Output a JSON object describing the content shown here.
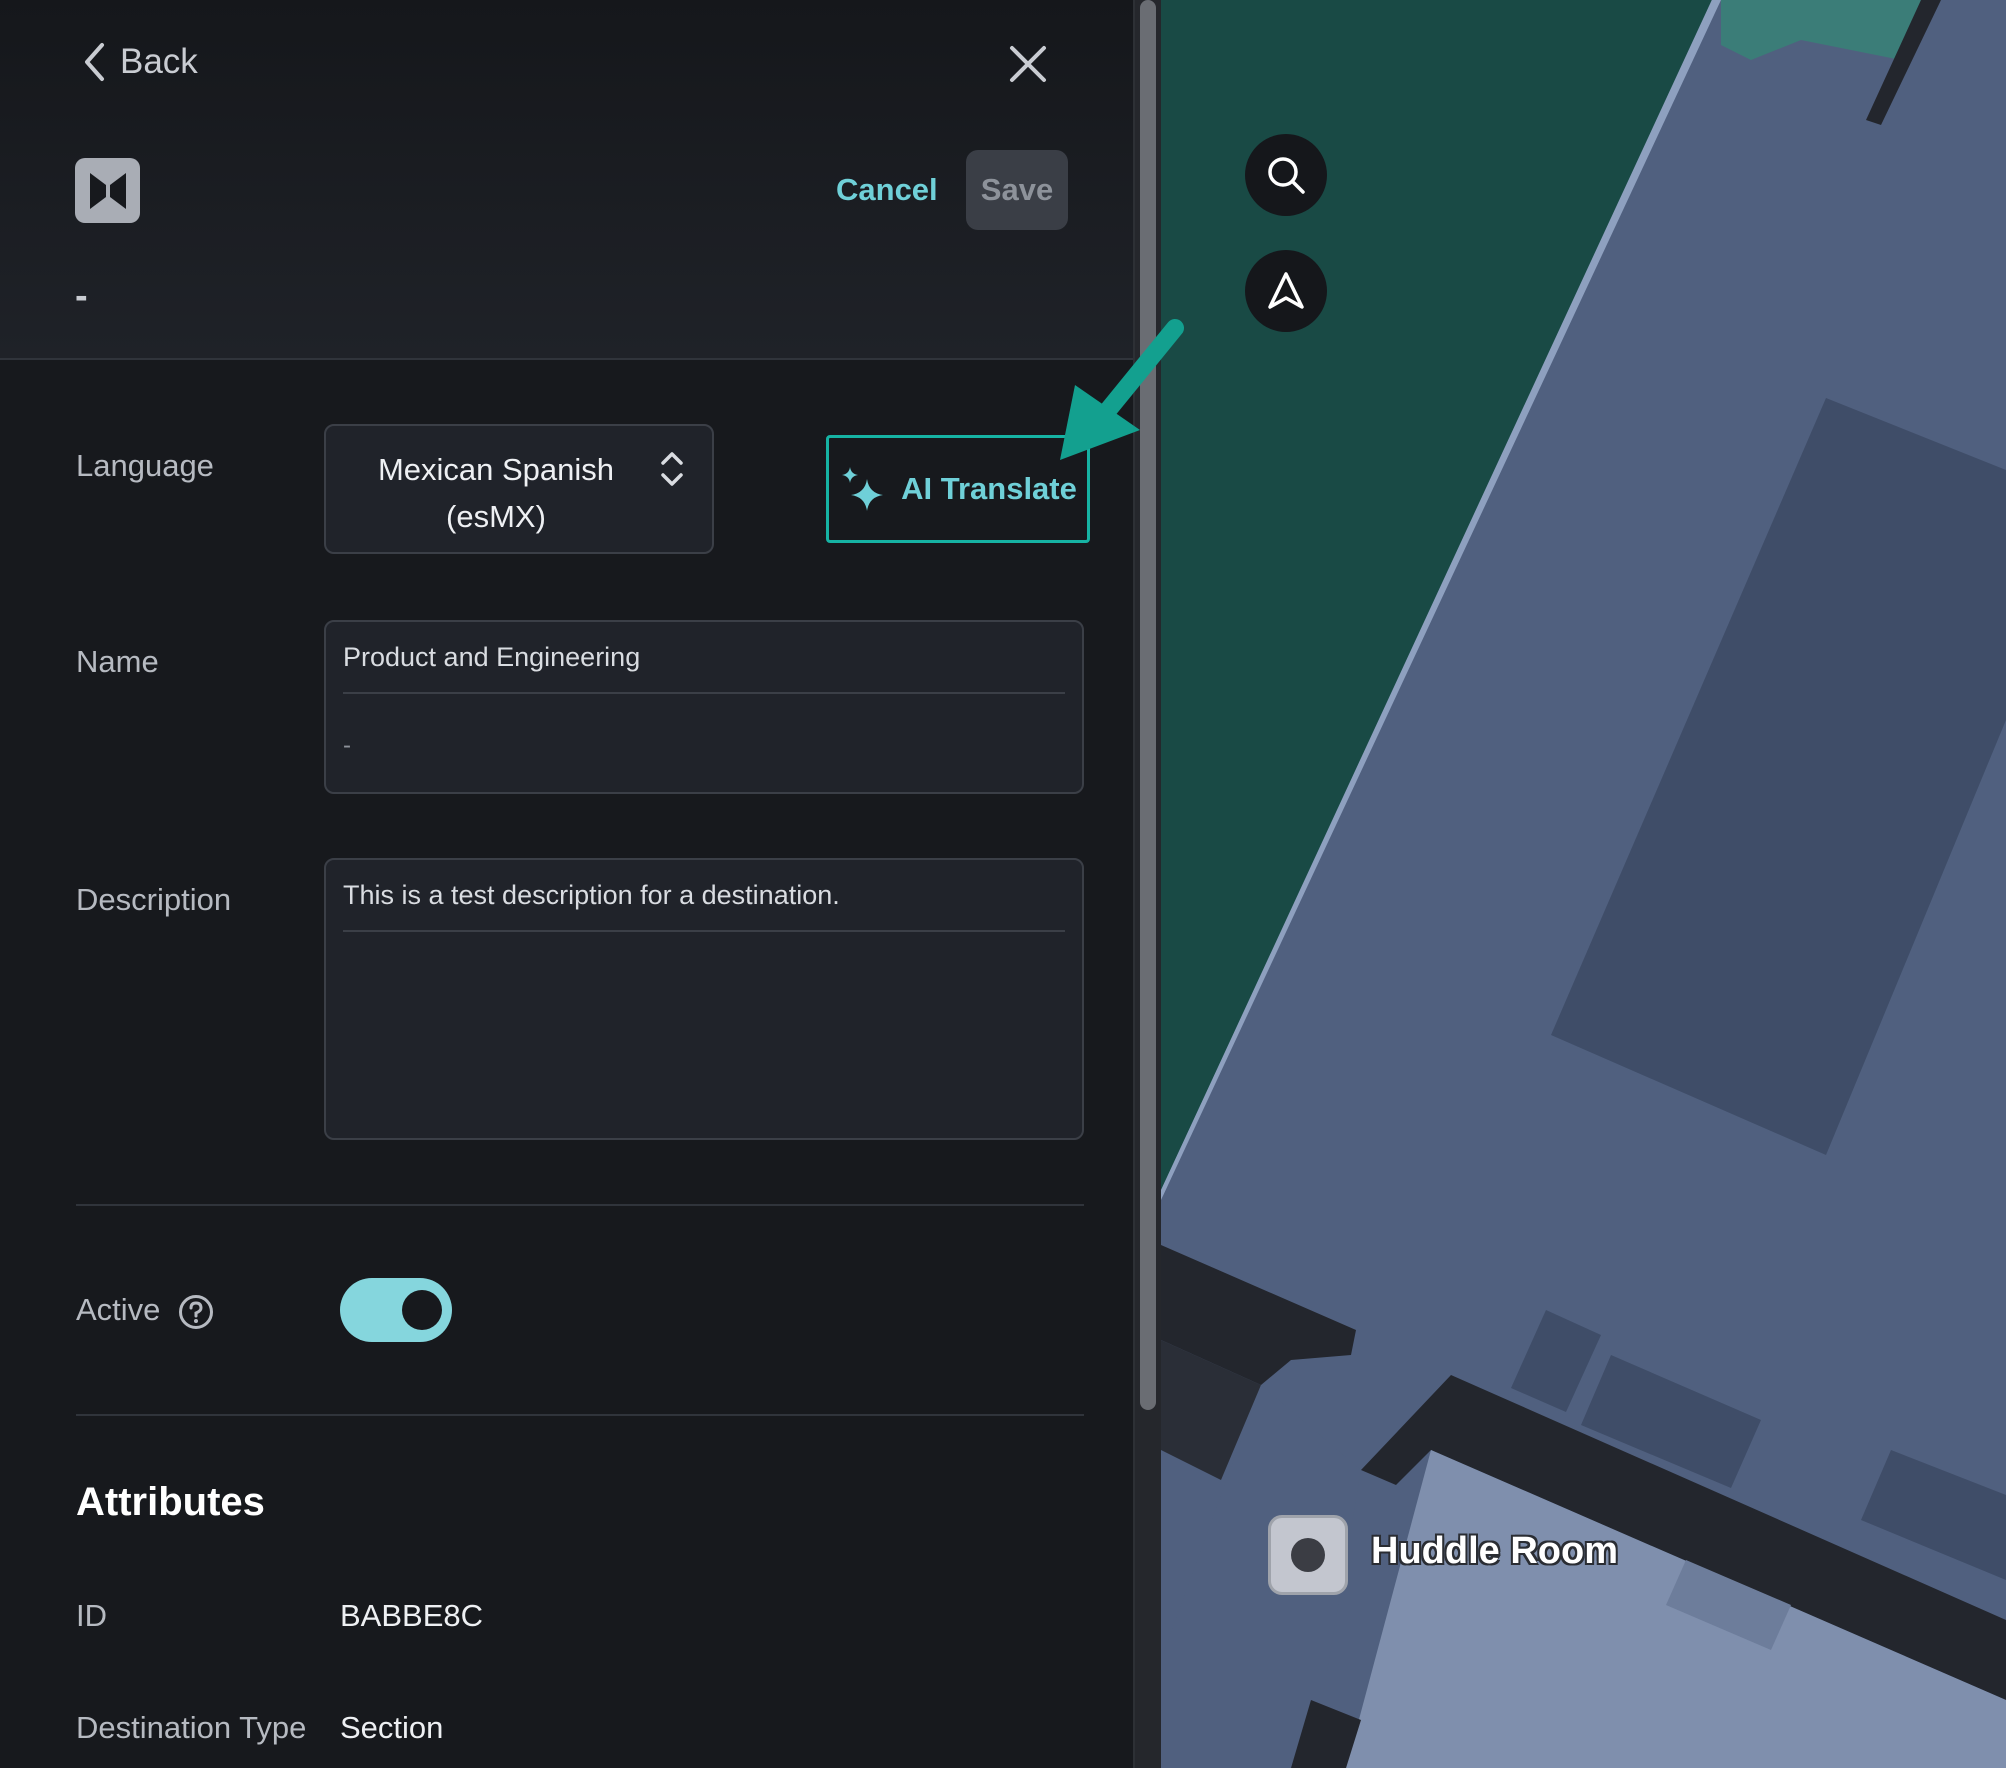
{
  "header": {
    "back_label": "Back",
    "cancel_label": "Cancel",
    "save_label": "Save",
    "subtitle": "-"
  },
  "form": {
    "language_label": "Language",
    "language_value": "Mexican Spanish (esMX)",
    "ai_translate_label": "AI Translate",
    "name_label": "Name",
    "name_value": "Product and Engineering",
    "name_translation": "-",
    "description_label": "Description",
    "description_value": "This is a test description for a destination.",
    "active_label": "Active",
    "active_on": true
  },
  "attributes": {
    "title": "Attributes",
    "rows": [
      {
        "label": "ID",
        "value": "BABBE8C"
      },
      {
        "label": "Destination Type",
        "value": "Section"
      }
    ]
  },
  "map": {
    "marker_label": "Huddle Room"
  },
  "colors": {
    "accent": "#6fd0d8",
    "translate_border": "#16b3a4",
    "toggle_on": "#85d6dd",
    "map_green": "#194a45",
    "map_floor": "#50607f",
    "annotation_arrow": "#13a08f"
  }
}
